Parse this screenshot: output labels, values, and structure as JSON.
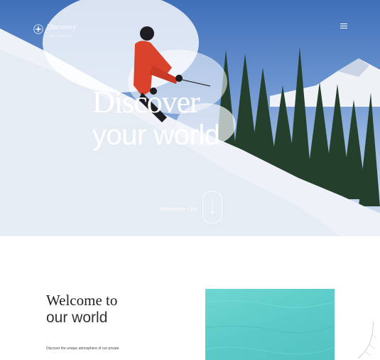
{
  "brand": {
    "name": "Discovery",
    "tagline": "LAND COMPANY",
    "logo_icon": "compass-star-icon"
  },
  "header": {
    "menu_icon": "hamburger-menu-icon"
  },
  "hero": {
    "headline_line1": "Discover",
    "headline_line2": "your world",
    "location_caption": "Yellowstone Club",
    "scroll_icon": "arrow-down-icon"
  },
  "welcome": {
    "title_line1": "Welcome to",
    "title_line2": "our world",
    "intro_text": "Discover the unique atmosphere of our private"
  },
  "colors": {
    "sky": "#4a78bf",
    "snow": "#eef2f8",
    "pool": "#5ccbc8",
    "jacket": "#d9432c"
  }
}
